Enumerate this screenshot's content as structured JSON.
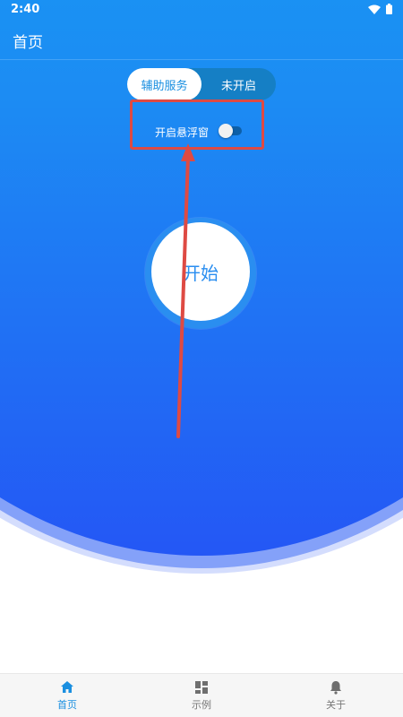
{
  "status_bar": {
    "time": "2:40"
  },
  "app_bar": {
    "title": "首页"
  },
  "segmented": {
    "options": [
      {
        "label": "辅助服务",
        "active": true
      },
      {
        "label": "未开启",
        "active": false
      }
    ]
  },
  "floating_window": {
    "label": "开启悬浮窗",
    "enabled": false
  },
  "start_button": {
    "label": "开始"
  },
  "bottom_nav": {
    "items": [
      {
        "label": "首页",
        "icon": "home-icon",
        "active": true
      },
      {
        "label": "示例",
        "icon": "grid-icon",
        "active": false
      },
      {
        "label": "关于",
        "icon": "bell-icon",
        "active": false
      }
    ]
  },
  "colors": {
    "primary": "#1a8fe0",
    "annotation": "#de4a43"
  }
}
